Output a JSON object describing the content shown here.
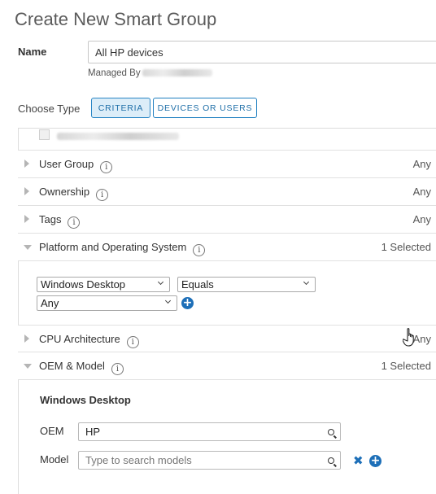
{
  "page": {
    "title": "Create New Smart Group"
  },
  "name": {
    "label": "Name",
    "value": "All HP devices",
    "managed_by_label": "Managed By"
  },
  "choose_type": {
    "label": "Choose Type",
    "options": [
      "CRITERIA",
      "DEVICES OR USERS"
    ],
    "selected": "CRITERIA"
  },
  "criteria": [
    {
      "label": "User Group",
      "value": "Any",
      "expanded": false
    },
    {
      "label": "Ownership",
      "value": "Any",
      "expanded": false
    },
    {
      "label": "Tags",
      "value": "Any",
      "expanded": false
    },
    {
      "label": "Platform and Operating System",
      "value": "1 Selected",
      "expanded": true
    },
    {
      "label": "CPU Architecture",
      "value": "Any",
      "expanded": false
    },
    {
      "label": "OEM & Model",
      "value": "1 Selected",
      "expanded": true
    }
  ],
  "platform": {
    "platform_value": "Windows Desktop",
    "operator_value": "Equals",
    "version_value": "Any"
  },
  "oem_model": {
    "platform_title": "Windows Desktop",
    "oem_label": "OEM",
    "oem_value": "HP",
    "model_label": "Model",
    "model_placeholder": "Type to search models"
  },
  "icons": {
    "info": "info-icon",
    "add": "add-circle-icon",
    "remove": "close-icon",
    "search": "search-icon",
    "expand": "caret-icon",
    "cursor": "hand-cursor-icon"
  },
  "colors": {
    "accent": "#1d6fb8",
    "active_button_bg": "#dcedf8"
  }
}
